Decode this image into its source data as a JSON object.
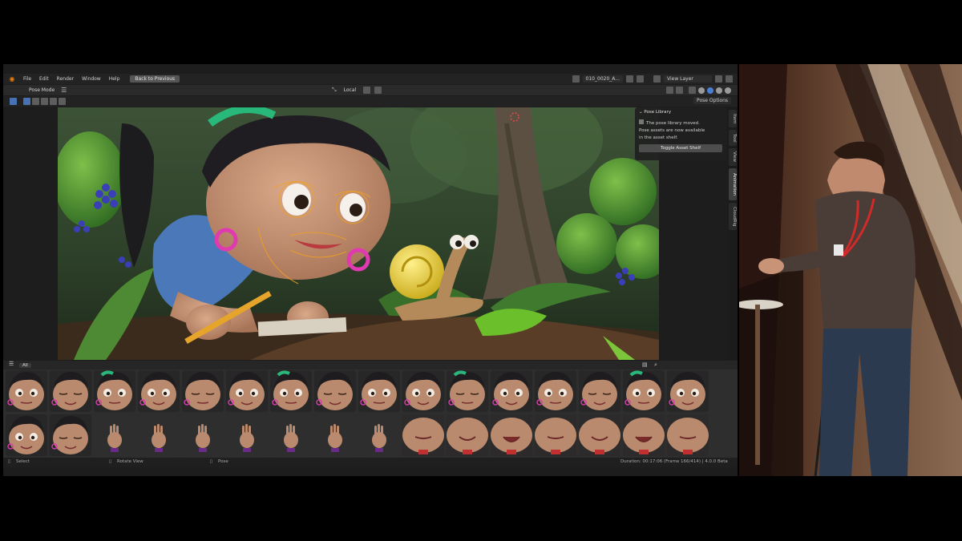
{
  "menubar": {
    "items": [
      "File",
      "Edit",
      "Render",
      "Window",
      "Help"
    ],
    "back_button": "Back to Previous",
    "scene_name": "010_0020_A...",
    "view_layer": "View Layer"
  },
  "header": {
    "mode": "Pose Mode",
    "transform_orientation": "Local"
  },
  "tool_header": {
    "pose_options": "Pose Options"
  },
  "pose_library_panel": {
    "title": "Pose Library",
    "message": "The pose library moved.",
    "line1": "Pose assets are now available",
    "line2": "in the asset shelf.",
    "toggle_button": "Toggle Asset Shelf"
  },
  "sidebar_tabs": [
    "Item",
    "Tool",
    "View",
    "Animation",
    "CloudRig"
  ],
  "sidebar_active_tab": "Animation",
  "asset_shelf": {
    "catalog": "All"
  },
  "statusbar": {
    "select": "Select",
    "rotate": "Rotate View",
    "pose": "Pose",
    "info": "Duration: 00:17:06 (Frame 166/414) | 4.0.0 Beta"
  },
  "colors": {
    "blender_bg": "#1d1d1d",
    "accent_blue": "#4772b3",
    "blender_orange": "#e87d0d"
  }
}
